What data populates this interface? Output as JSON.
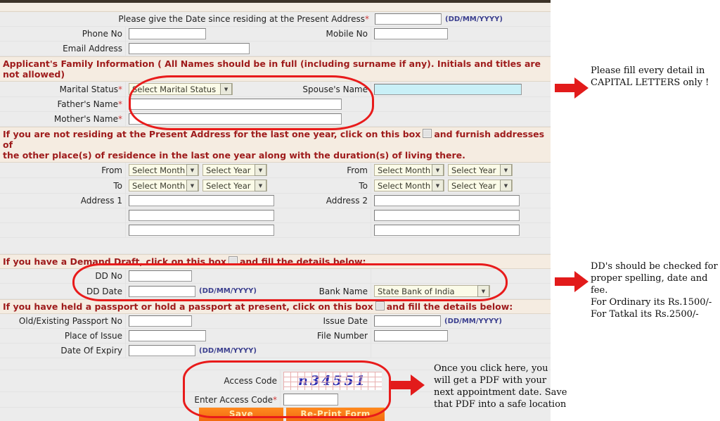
{
  "form": {
    "present_address_date": {
      "label": "Please give the Date since residing at the Present Address",
      "required": "*",
      "value": "",
      "hint": "(DD/MM/YYYY)"
    },
    "phone_no": {
      "label": "Phone No",
      "value": ""
    },
    "mobile_no": {
      "label": "Mobile No",
      "value": ""
    },
    "email_address": {
      "label": "Email Address",
      "value": ""
    },
    "family_section": "Applicant's Family Information ( All Names should be in full (including surname if any). Initials and titles are not allowed)",
    "marital_status": {
      "label": "Marital Status",
      "required": "*",
      "value": "Select Marital Status"
    },
    "spouse_name": {
      "label": "Spouse's Name",
      "value": ""
    },
    "fathers_name": {
      "label": "Father's Name",
      "required": "*",
      "value": ""
    },
    "mothers_name": {
      "label": "Mother's Name",
      "required": "*",
      "value": ""
    },
    "residence_section_line1": "If you are not residing at the Present Address for the last one year, click on this box",
    "residence_section_line2": "and furnish addresses of",
    "residence_section_line3": "the other place(s) of residence in the last one year along with the duration(s) of living there.",
    "from_label_1": "From",
    "to_label_1": "To",
    "from_label_2": "From",
    "to_label_2": "To",
    "select_month": "Select Month",
    "select_year": "Select Year",
    "address_1": {
      "label": "Address 1",
      "value": "",
      "line2": "",
      "line3": ""
    },
    "address_2": {
      "label": "Address 2",
      "value": "",
      "line2": "",
      "line3": ""
    },
    "dd_section_line1": "If you have a Demand Draft, click on this box",
    "dd_section_line2": "and fill the details below:",
    "dd_no": {
      "label": "DD No",
      "value": ""
    },
    "dd_date": {
      "label": "DD Date",
      "value": "",
      "hint": "(DD/MM/YYYY)"
    },
    "bank_name": {
      "label": "Bank Name",
      "value": "State Bank of India"
    },
    "passport_section_line1": "If you have held a passport or hold a passport at present, click on this box",
    "passport_section_line2": "and fill the details below:",
    "old_passport_no": {
      "label": "Old/Existing Passport No",
      "value": ""
    },
    "issue_date": {
      "label": "Issue Date",
      "value": "",
      "hint": "(DD/MM/YYYY)"
    },
    "place_of_issue": {
      "label": "Place of Issue",
      "value": ""
    },
    "file_number": {
      "label": "File Number",
      "value": ""
    },
    "date_of_expiry": {
      "label": "Date Of Expiry",
      "value": "",
      "hint": "(DD/MM/YYYY)"
    },
    "access_code": {
      "label": "Access Code",
      "value": "n34551"
    },
    "enter_access_code": {
      "label": "Enter Access Code",
      "required": "*",
      "value": ""
    },
    "save_button": "Save",
    "reprint_button": "Re-Print Form"
  },
  "annotations": {
    "note_capitals": "Please fill every detail in\nCAPITAL LETTERS only !",
    "note_dd": "DD's should be checked for\nproper spelling, date and fee.\nFor Ordinary its Rs.1500/-\nFor Tatkal its Rs.2500/-",
    "note_pdf": "Once you click here, you\nwill get a PDF with your\nnext appointment date. Save\nthat PDF into a safe location"
  },
  "colors": {
    "accent_red": "#e81b1b",
    "section_text": "#9e1b1b",
    "row_bg": "#ececec",
    "section_bg": "#f5ece1",
    "button_orange": "#f26a10",
    "hint_blue": "#3b3f8f",
    "captcha_blue": "#2a2ab0",
    "highlight_cyan": "#c9f0f7"
  }
}
